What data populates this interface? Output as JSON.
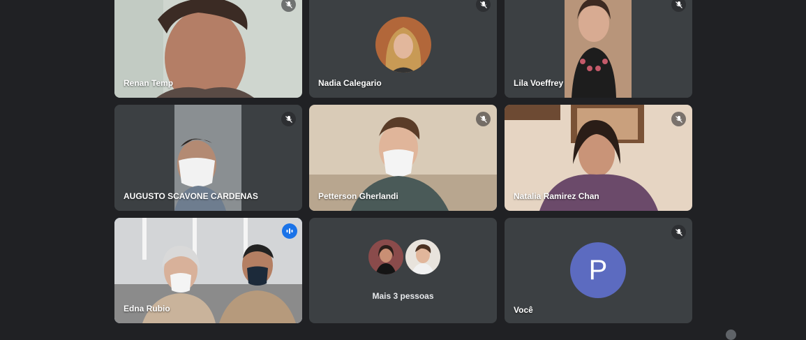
{
  "participants": [
    {
      "name": "Renan Temp",
      "mic": "muted"
    },
    {
      "name": "Nadia Calegario",
      "mic": "muted"
    },
    {
      "name": "Lila Voeffrey",
      "mic": "muted"
    },
    {
      "name": "AUGUSTO SCAVONE CARDENAS",
      "mic": "muted"
    },
    {
      "name": "Petterson Gherlandi",
      "mic": "muted"
    },
    {
      "name": "Natalia Ramirez Chan",
      "mic": "muted"
    },
    {
      "name": "Edna Rubio",
      "mic": "speaking"
    },
    {
      "name": "Mais 3 pessoas",
      "mic": "none"
    },
    {
      "name": "Você",
      "mic": "muted",
      "initial": "P"
    }
  ],
  "icons": {
    "muted": "mic-off-icon",
    "speaking": "audio-level-icon",
    "more": "more-options-icon"
  },
  "colors": {
    "background": "#202124",
    "tile": "#3c4043",
    "active_speaker": "#1a73e8",
    "self_avatar": "#5c6bc0"
  }
}
